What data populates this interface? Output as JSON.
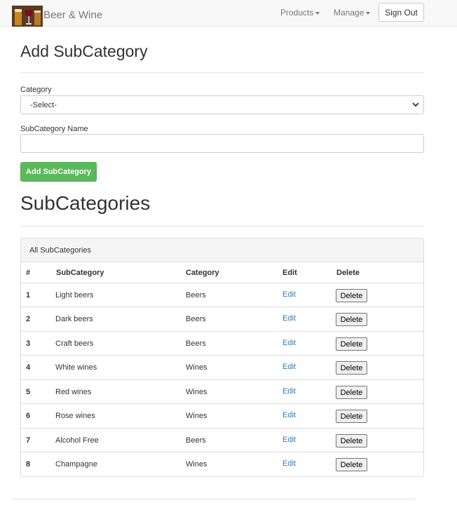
{
  "navbar": {
    "brand": "Beer & Wine",
    "products_label": "Products",
    "manage_label": "Manage",
    "signout_label": "Sign Out"
  },
  "form": {
    "title": "Add SubCategory",
    "category_label": "Category",
    "category_selected": "-Select-",
    "subcategory_label": "SubCategory Name",
    "subcategory_value": "",
    "submit_label": "Add SubCategory"
  },
  "list": {
    "title": "SubCategories",
    "panel_heading": "All SubCategories",
    "columns": [
      "#",
      "SubCategory",
      "Category",
      "Edit",
      "Delete"
    ],
    "rows": [
      {
        "num": "1",
        "subcategory": "Light beers",
        "category": "Beers",
        "edit": "Edit",
        "delete": "Delete"
      },
      {
        "num": "2",
        "subcategory": "Dark beers",
        "category": "Beers",
        "edit": "Edit",
        "delete": "Delete"
      },
      {
        "num": "3",
        "subcategory": "Craft beers",
        "category": "Beers",
        "edit": "Edit",
        "delete": "Delete"
      },
      {
        "num": "4",
        "subcategory": "White wines",
        "category": "Wines",
        "edit": "Edit",
        "delete": "Delete"
      },
      {
        "num": "5",
        "subcategory": "Red wines",
        "category": "Wines",
        "edit": "Edit",
        "delete": "Delete"
      },
      {
        "num": "6",
        "subcategory": "Rose wines",
        "category": "Wines",
        "edit": "Edit",
        "delete": "Delete"
      },
      {
        "num": "7",
        "subcategory": "Alcohol Free",
        "category": "Beers",
        "edit": "Edit",
        "delete": "Delete"
      },
      {
        "num": "8",
        "subcategory": "Champagne",
        "category": "Wines",
        "edit": "Edit",
        "delete": "Delete"
      }
    ]
  },
  "icons": {
    "logo": "beer-wine-logo-icon",
    "caret": "caret-down-icon",
    "select_chevron": "chevron-down-icon"
  },
  "colors": {
    "success": "#5cb85c",
    "link": "#337ab7",
    "navbar_bg": "#f8f8f8"
  }
}
